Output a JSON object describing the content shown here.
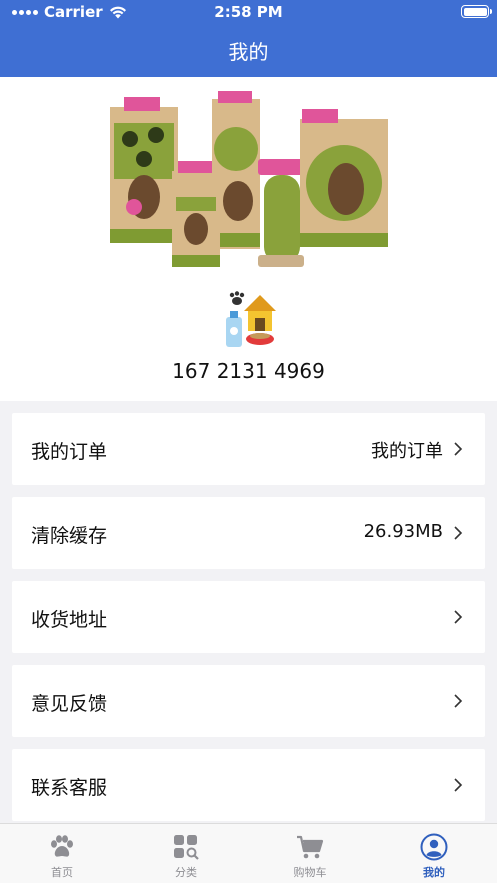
{
  "status_bar": {
    "carrier": "Carrier",
    "time": "2:58 PM"
  },
  "header": {
    "title": "我的"
  },
  "profile": {
    "phone": "167 2131 4969",
    "banner_icon": "pet-products-banner",
    "avatar_icon": "pet-house-icon"
  },
  "menu": [
    {
      "label": "我的订单",
      "value": "我的订单"
    },
    {
      "label": "清除缓存",
      "value": "26.93MB"
    },
    {
      "label": "收货地址",
      "value": ""
    },
    {
      "label": "意见反馈",
      "value": ""
    },
    {
      "label": "联系客服",
      "value": ""
    }
  ],
  "tabbar": {
    "items": [
      {
        "label": "首页",
        "icon": "paw-icon"
      },
      {
        "label": "分类",
        "icon": "category-icon"
      },
      {
        "label": "购物车",
        "icon": "cart-icon"
      },
      {
        "label": "我的",
        "icon": "user-icon"
      }
    ],
    "active_index": 3
  },
  "colors": {
    "header_bg": "#3f6fd3",
    "tab_active": "#2f5fbd",
    "tab_inactive": "#8e8e93"
  }
}
